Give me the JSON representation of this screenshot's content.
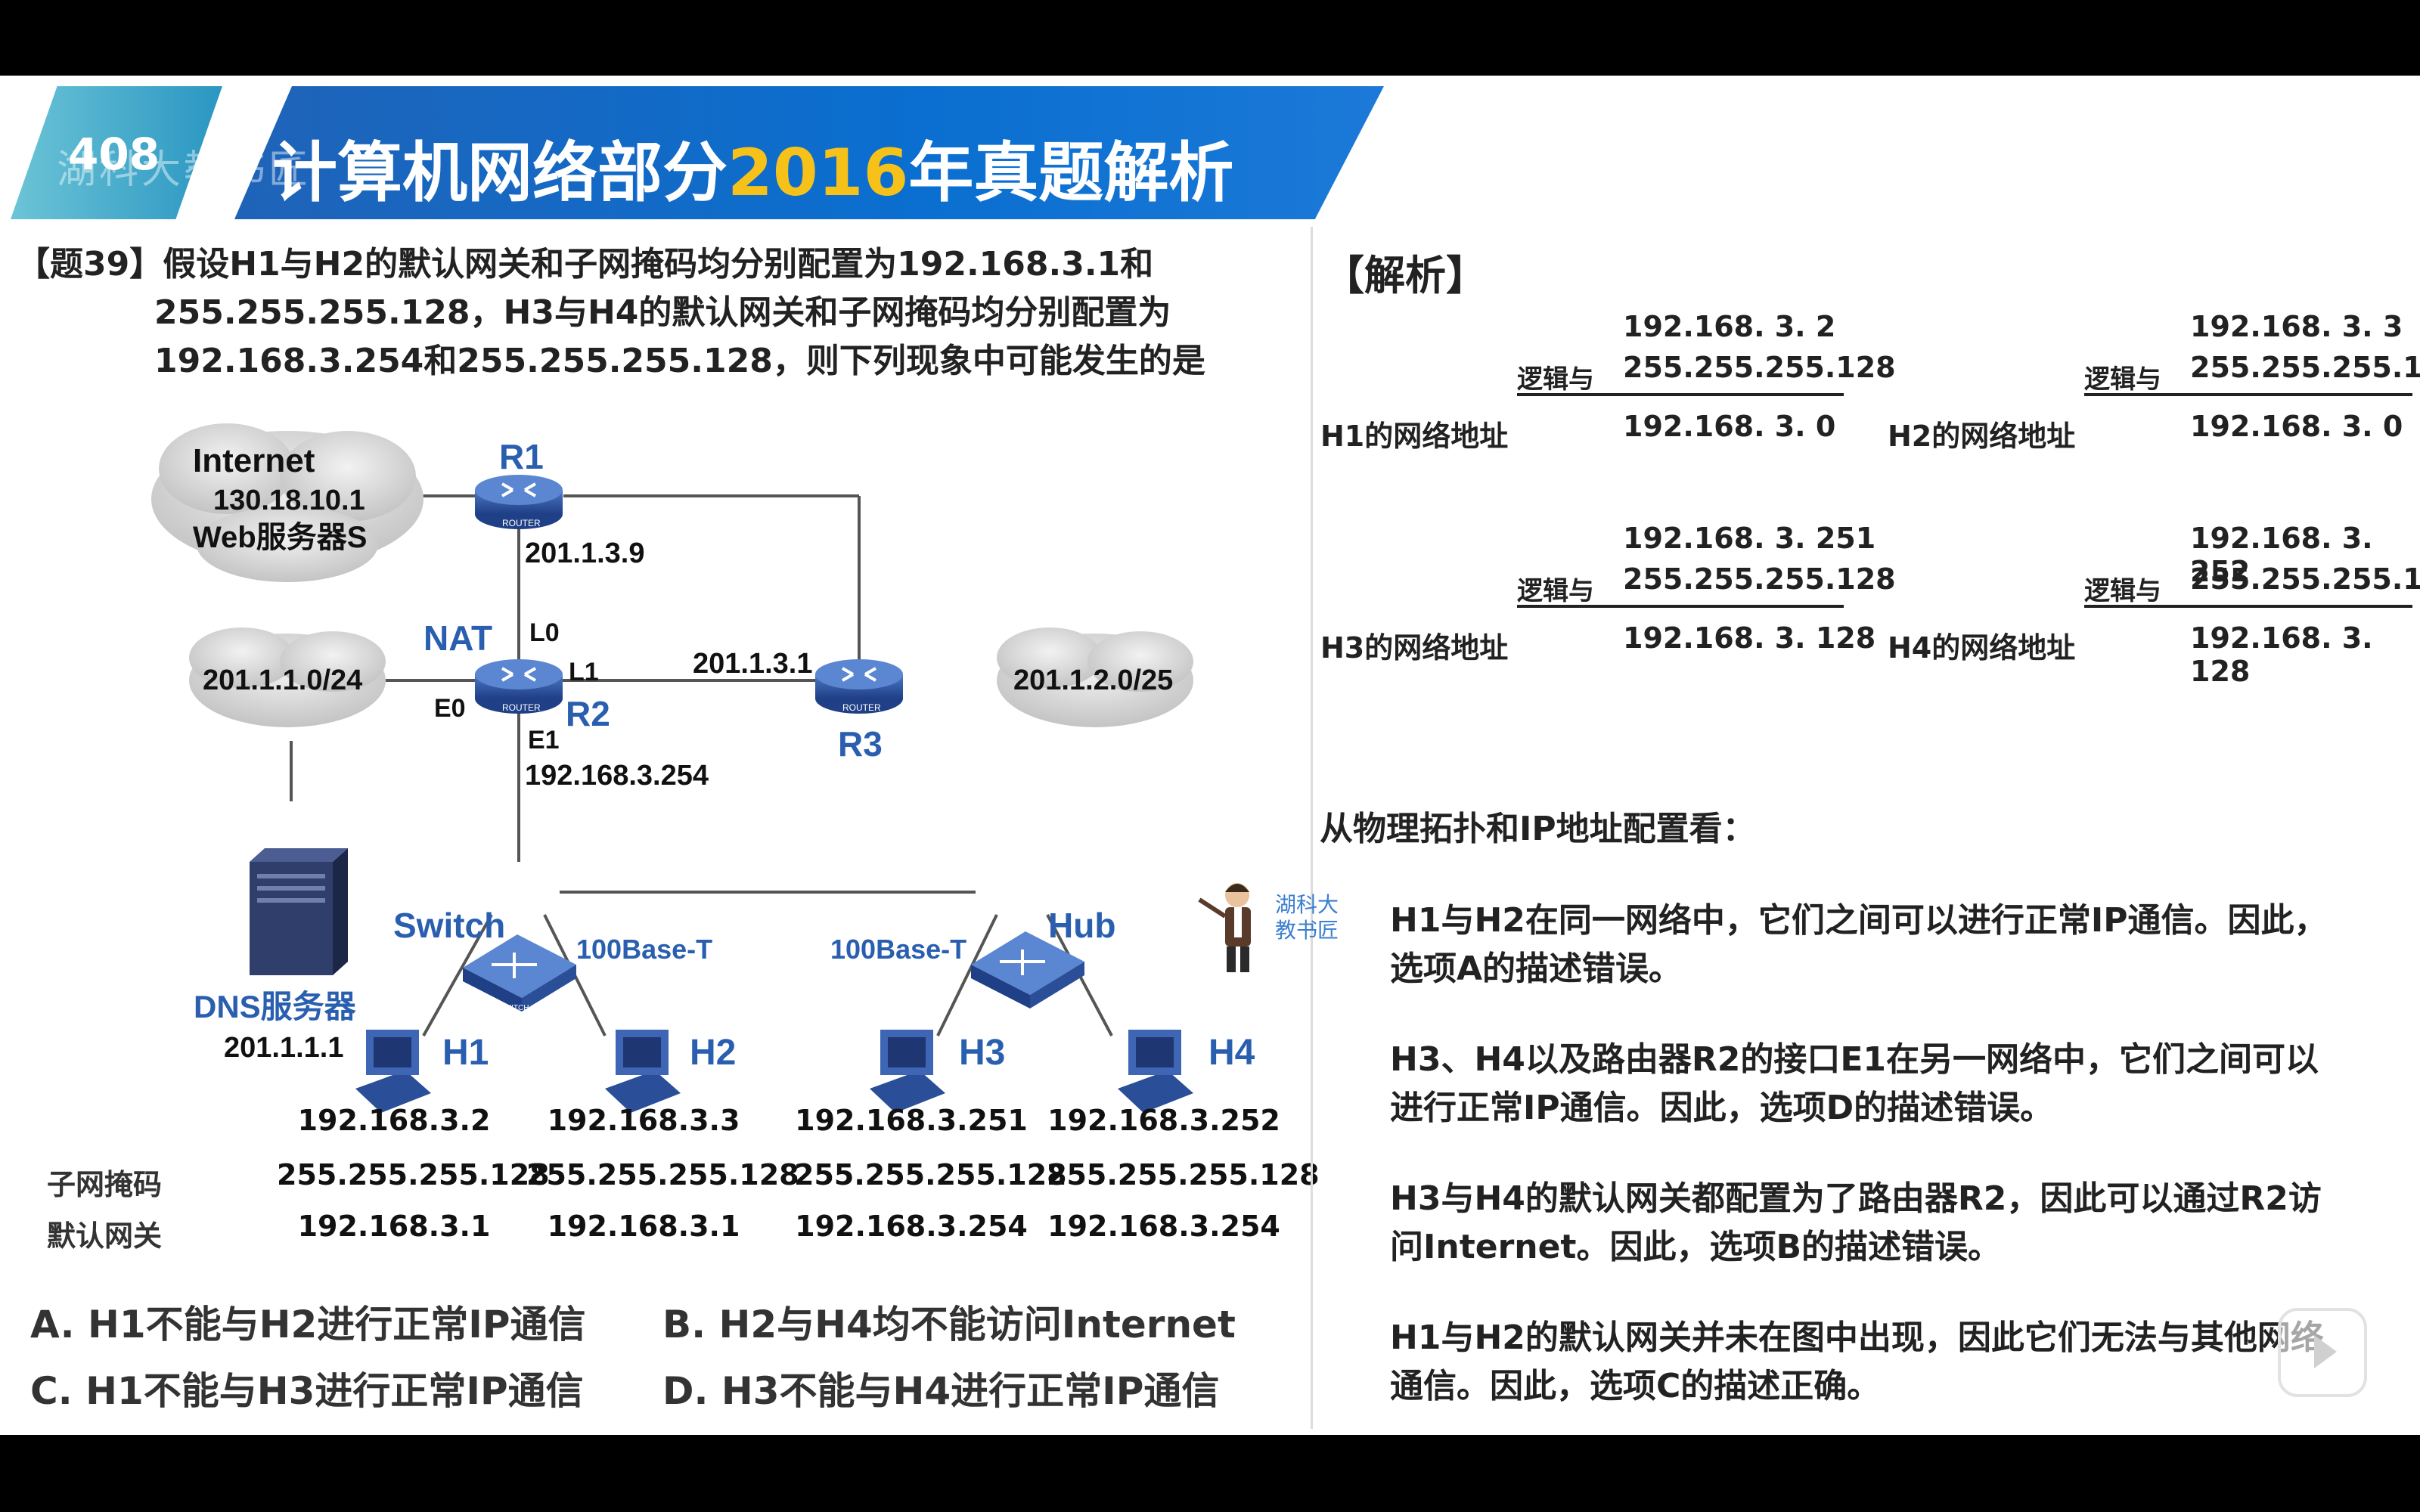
{
  "header": {
    "number": "408",
    "watermark": "湖科大教书匠",
    "title_pre": "计算机网络部分",
    "title_year": "2016",
    "title_post": "年真题解析"
  },
  "question": {
    "line1": "【题39】假设H1与H2的默认网关和子网掩码均分别配置为192.168.3.1和",
    "line2": "255.255.255.128，H3与H4的默认网关和子网掩码均分别配置为",
    "line3": "192.168.3.254和255.255.255.128，则下列现象中可能发生的是"
  },
  "topology": {
    "internet_label": "Internet",
    "internet_ip": "130.18.10.1",
    "web_server": "Web服务器S",
    "r1": "R1",
    "r1_ip": "201.1.3.9",
    "nat": "NAT",
    "l0": "L0",
    "l1": "L1",
    "r2": "R2",
    "e0": "E0",
    "e1": "E1",
    "e1_ip": "192.168.3.254",
    "r2_r3_ip": "201.1.3.1",
    "r3": "R3",
    "net1": "201.1.1.0/24",
    "net2": "201.1.2.0/25",
    "dns": "DNS服务器",
    "dns_ip": "201.1.1.1",
    "switch": "Switch",
    "hub": "Hub",
    "link1": "100Base-T",
    "link2": "100Base-T",
    "router_tag": "ROUTER",
    "switch_tag": "SWITCH"
  },
  "hosts": [
    {
      "name": "H1",
      "ip": "192.168.3.2",
      "mask": "255.255.255.128",
      "gw": "192.168.3.1"
    },
    {
      "name": "H2",
      "ip": "192.168.3.3",
      "mask": "255.255.255.128",
      "gw": "192.168.3.1"
    },
    {
      "name": "H3",
      "ip": "192.168.3.251",
      "mask": "255.255.255.128",
      "gw": "192.168.3.254"
    },
    {
      "name": "H4",
      "ip": "192.168.3.252",
      "mask": "255.255.255.128",
      "gw": "192.168.3.254"
    }
  ],
  "table_labels": {
    "mask": "子网掩码",
    "gateway": "默认网关"
  },
  "options": {
    "a": "A. H1不能与H2进行正常IP通信",
    "b": "B. H2与H4均不能访问Internet",
    "c": "C. H1不能与H3进行正常IP通信",
    "d": "D. H3不能与H4进行正常IP通信"
  },
  "analysis": {
    "title": "【解析】",
    "and_label": "逻辑与",
    "mask": "255.255.255.128",
    "blocks": [
      {
        "ip": "192.168.  3.    2",
        "label": "H1的网络地址",
        "result": "192.168.  3.    0"
      },
      {
        "ip": "192.168.  3.    3",
        "label": "H2的网络地址",
        "result": "192.168.  3.    0"
      },
      {
        "ip": "192.168.  3. 251",
        "label": "H3的网络地址",
        "result": "192.168.  3. 128"
      },
      {
        "ip": "192.168.  3. 252",
        "label": "H4的网络地址",
        "result": "192.168.  3. 128"
      }
    ],
    "subhead": "从物理拓扑和IP地址配置看：",
    "paragraphs": [
      "H1与H2在同一网络中，它们之间可以进行正常IP通信。因此，选项A的描述错误。",
      "H3、H4以及路由器R2的接口E1在另一网络中，它们之间可以进行正常IP通信。因此，选项D的描述错误。",
      "H3与H4的默认网关都配置为了路由器R2，因此可以通过R2访问Internet。因此，选项B的描述错误。",
      "H1与H2的默认网关并未在图中出现，因此它们无法与其他网络通信。因此，选项C的描述正确。"
    ]
  },
  "teacher_label": "湖科大教书匠",
  "colors": {
    "header_blue": "#1f63b8",
    "year_yellow": "#f6c21a",
    "device_blue": "#2a4f98"
  }
}
